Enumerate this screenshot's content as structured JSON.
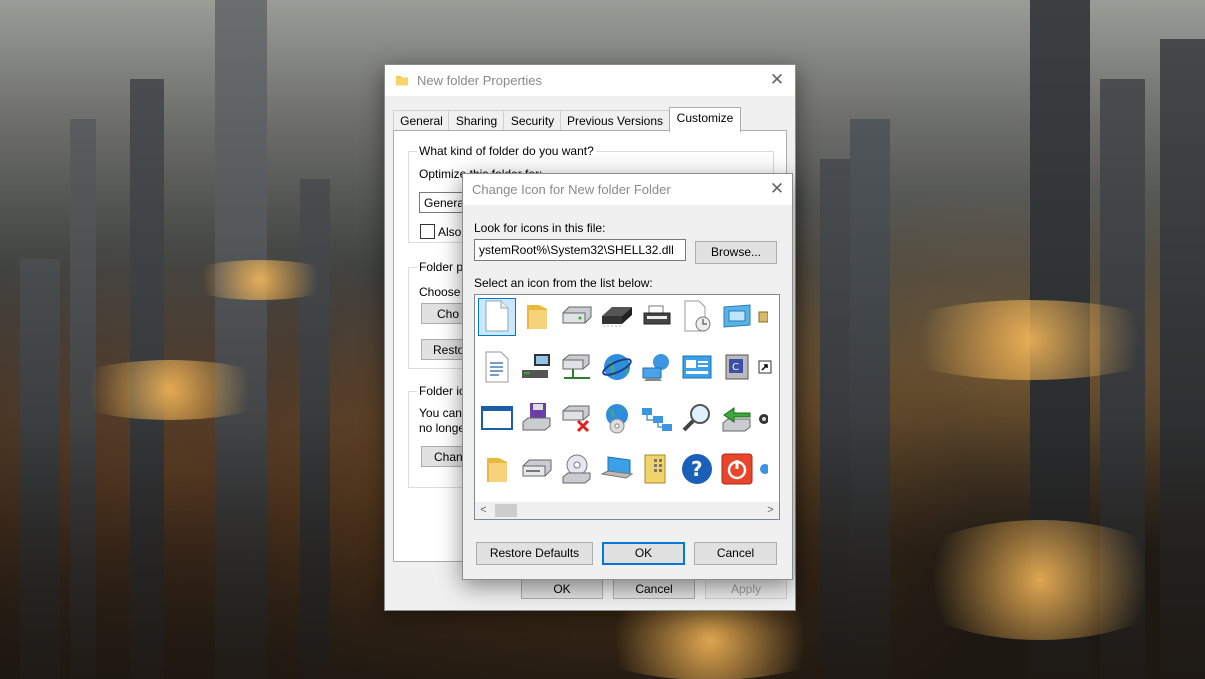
{
  "properties_window": {
    "title": "New folder Properties",
    "tabs": [
      "General",
      "Sharing",
      "Security",
      "Previous Versions",
      "Customize"
    ],
    "active_tab": "Customize",
    "question": "What kind of folder do you want?",
    "optimize_label": "Optimize this folder for:",
    "optimize_value": "Genera",
    "also_apply_label": "Also",
    "folder_pictures_label": "Folder p",
    "choose_label": "Choose",
    "choose_button": "Cho",
    "restore_button": "Resto",
    "folder_icons_label": "Folder ic",
    "folder_icons_text_1": "You can",
    "folder_icons_text_2": "no longe",
    "change_button": "Chan",
    "ok": "OK",
    "cancel": "Cancel",
    "apply": "Apply"
  },
  "change_icon_dialog": {
    "title": "Change Icon for New folder Folder",
    "look_for_label": "Look for icons in this file:",
    "file_path": "ystemRoot%\\System32\\SHELL32.dll",
    "browse_button": "Browse...",
    "select_label": "Select an icon from the list below:",
    "restore_defaults_button": "Restore Defaults",
    "ok_button": "OK",
    "cancel_button": "Cancel",
    "scroll_left": "<",
    "scroll_right": ">"
  },
  "icons": [
    [
      "blank-document-icon",
      "folder-icon",
      "hard-drive-icon",
      "memory-chip-icon",
      "printer-icon",
      "document-clock-icon",
      "window-monitor-icon",
      "partial-icon"
    ],
    [
      "text-document-icon",
      "network-computer-icon",
      "network-drive-icon",
      "internet-globe-icon",
      "network-globe-icon",
      "control-panel-icon",
      "control-panel-window-icon",
      "shortcut-arrow-icon"
    ],
    [
      "blank-window-icon",
      "floppy-drive-icon",
      "disconnected-drive-icon",
      "globe-cd-icon",
      "network-tree-icon",
      "search-magnifier-icon",
      "run-arrow-icon",
      "partial-icon"
    ],
    [
      "folder-icon",
      "cd-drive-icon",
      "cd-disc-icon",
      "laptop-computer-icon",
      "notepad-grid-icon",
      "help-question-icon",
      "shutdown-power-icon",
      "partial-icon"
    ]
  ],
  "colors": {
    "accent": "#0078d7",
    "selection": "#cce8ff",
    "dialog_bg": "#f0f0f0"
  }
}
